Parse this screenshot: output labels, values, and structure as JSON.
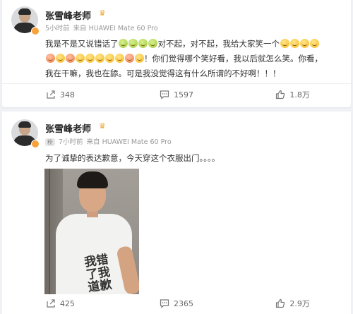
{
  "posts": [
    {
      "author": "张雪峰老师",
      "time": "5小时前",
      "source": "来自 HUAWEI Mate 60 Pro",
      "text_segments": {
        "a": "我是不是又说错话了",
        "b": "对不起，对不起，我给大家笑一个",
        "c": "！你们觉得哪个笑好看，我以后就怎么笑。你看，",
        "d": "我在干嘛，我也在舔。可是我没觉得这有什么所谓的不好啊！！！"
      },
      "actions": {
        "share": "348",
        "comment": "1597",
        "like": "1.8万"
      }
    },
    {
      "author": "张雪峰老师",
      "fan_tag": "粉",
      "time": "7小时前",
      "source": "来自 HUAWEI Mate 60 Pro",
      "text": "为了诚挚的表达歉意，今天穿这个衣服出门。。。。",
      "shirt_print": "我错了我道歉",
      "actions": {
        "share": "425",
        "comment": "2365",
        "like": "2.9万"
      }
    }
  ],
  "colors": {
    "background": "#f0f1f4",
    "card": "#ffffff",
    "badge": "#f7a23a",
    "meta": "#999999"
  }
}
